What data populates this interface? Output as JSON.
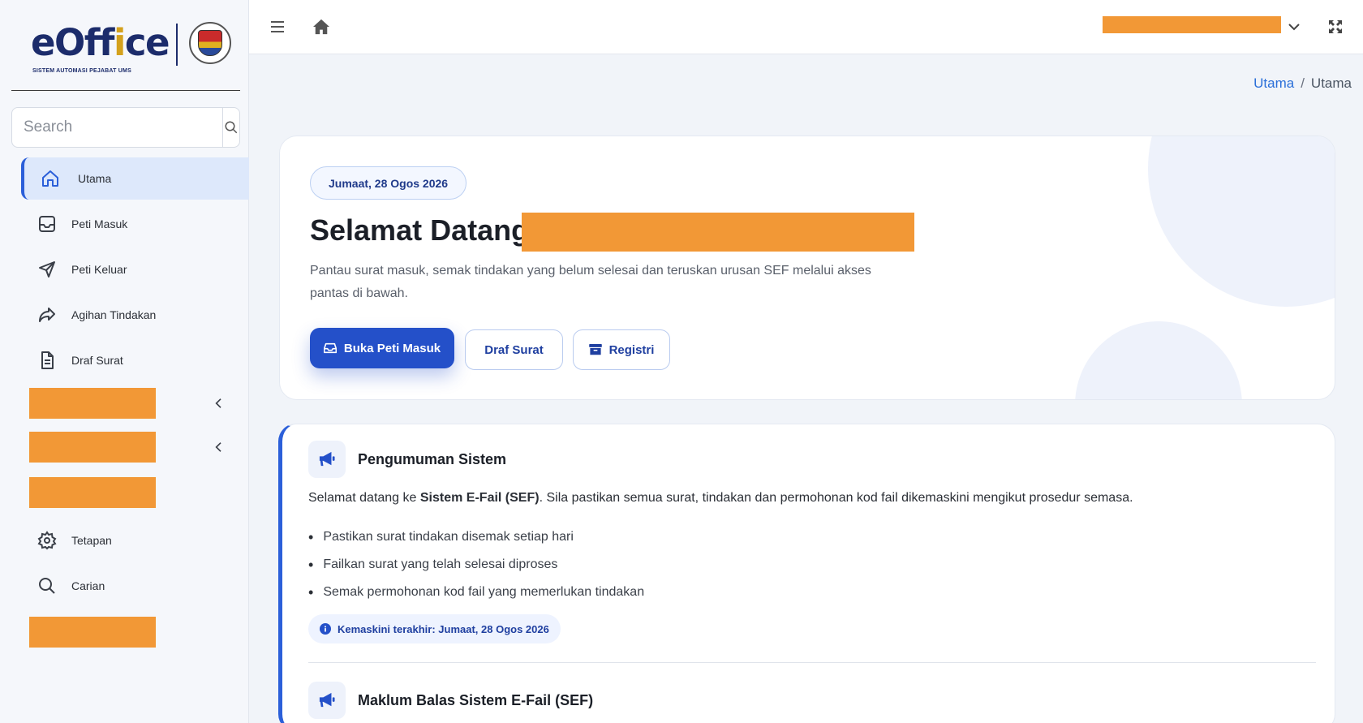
{
  "brand": {
    "logo_part1": "eOff",
    "logo_accent": "i",
    "logo_part2": "ce",
    "subtitle": "SISTEM AUTOMASI PEJABAT UMS"
  },
  "search": {
    "placeholder": "Search"
  },
  "sidebar": {
    "items": [
      {
        "label": "Utama",
        "icon": "home-icon",
        "active": true
      },
      {
        "label": "Peti Masuk",
        "icon": "inbox-icon"
      },
      {
        "label": "Peti Keluar",
        "icon": "send-icon"
      },
      {
        "label": "Agihan Tindakan",
        "icon": "share-icon"
      },
      {
        "label": "Draf Surat",
        "icon": "document-icon"
      },
      {
        "label": "Tetapan",
        "icon": "gear-icon"
      },
      {
        "label": "Carian",
        "icon": "search-icon"
      }
    ]
  },
  "breadcrumb": {
    "link": "Utama",
    "separator": "/",
    "current": "Utama"
  },
  "hero": {
    "date": "Jumaat, 28 Ogos 2026",
    "title": "Selamat Datang,",
    "description": "Pantau surat masuk, semak tindakan yang belum selesai dan teruskan urusan SEF melalui akses pantas di bawah.",
    "buttons": {
      "primary": "Buka Peti Masuk",
      "draf": "Draf Surat",
      "registri": "Registri"
    }
  },
  "announcement": {
    "title": "Pengumuman Sistem",
    "body_prefix": "Selamat datang ke ",
    "body_bold": "Sistem E-Fail (SEF)",
    "body_suffix": ". Sila pastikan semua surat, tindakan dan permohonan kod fail dikemaskini mengikut prosedur semasa.",
    "list": [
      "Pastikan surat tindakan disemak setiap hari",
      "Failkan surat yang telah selesai diproses",
      "Semak permohonan kod fail yang memerlukan tindakan"
    ],
    "updated": "Kemaskini terakhir: Jumaat, 28 Ogos 2026",
    "second_title": "Maklum Balas Sistem E-Fail (SEF)"
  },
  "colors": {
    "primary": "#2450c9",
    "redaction": "#f29836",
    "active_nav_bg": "#dde8fb"
  }
}
